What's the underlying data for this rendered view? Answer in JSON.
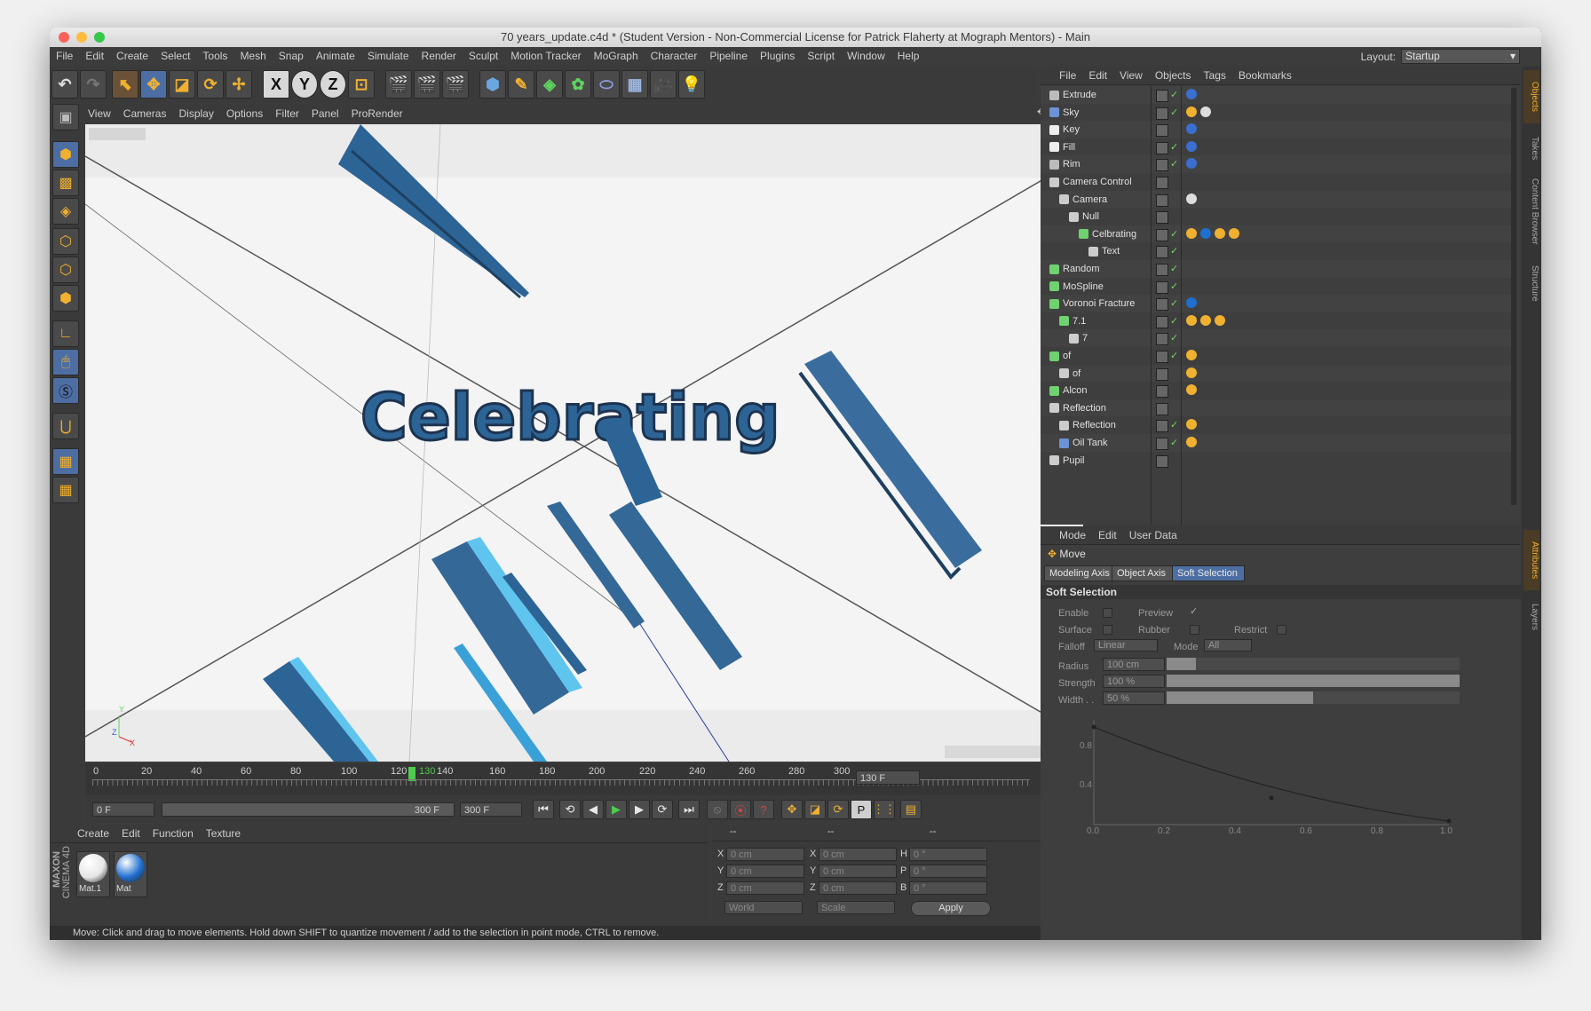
{
  "window": {
    "title": "70 years_update.c4d * (Student Version - Non-Commercial License for Patrick Flaherty at Mograph Mentors) - Main"
  },
  "menu": [
    "File",
    "Edit",
    "Create",
    "Select",
    "Tools",
    "Mesh",
    "Snap",
    "Animate",
    "Simulate",
    "Render",
    "Sculpt",
    "Motion Tracker",
    "MoGraph",
    "Character",
    "Pipeline",
    "Plugins",
    "Script",
    "Window",
    "Help"
  ],
  "layout": {
    "label": "Layout:",
    "value": "Startup"
  },
  "viewport": {
    "menu": [
      "View",
      "Cameras",
      "Display",
      "Options",
      "Filter",
      "Panel",
      "ProRender"
    ],
    "text3d": "Celebrating",
    "axis": {
      "x": "X",
      "y": "Y",
      "z": "Z"
    }
  },
  "timeline": {
    "ticks": [
      "0",
      "20",
      "40",
      "60",
      "80",
      "100",
      "120",
      "130",
      "140",
      "160",
      "180",
      "200",
      "220",
      "240",
      "260",
      "280",
      "300"
    ],
    "current": "130 F",
    "start": "0 F",
    "range_end": "300 F",
    "end": "300 F"
  },
  "materials": {
    "menu": [
      "Create",
      "Edit",
      "Function",
      "Texture"
    ],
    "items": [
      {
        "name": "Mat.1",
        "color": "#e6e6e6"
      },
      {
        "name": "Mat",
        "color": "#1f6fd0"
      }
    ],
    "brand1": "MAXON",
    "brand2": "CINEMA 4D"
  },
  "coords": {
    "headers": [
      "--",
      "--",
      "--"
    ],
    "rows": [
      {
        "a": "X",
        "av": "0 cm",
        "b": "X",
        "bv": "0 cm",
        "c": "H",
        "cv": "0 °"
      },
      {
        "a": "Y",
        "av": "0 cm",
        "b": "Y",
        "bv": "0 cm",
        "c": "P",
        "cv": "0 °"
      },
      {
        "a": "Z",
        "av": "0 cm",
        "b": "Z",
        "bv": "0 cm",
        "c": "B",
        "cv": "0 °"
      }
    ],
    "world": "World",
    "scale": "Scale",
    "apply": "Apply"
  },
  "status": "Move: Click and drag to move elements. Hold down SHIFT to quantize movement / add to the selection in point mode, CTRL to remove.",
  "objects": {
    "menu": [
      "File",
      "Edit",
      "View",
      "Objects",
      "Tags",
      "Bookmarks"
    ],
    "rows": [
      {
        "name": "Extrude",
        "indent": 0,
        "color": "#bbbbbb"
      },
      {
        "name": "Sky",
        "indent": 0,
        "color": "#6b93d6"
      },
      {
        "name": "Key",
        "indent": 0,
        "color": "#eeeeee"
      },
      {
        "name": "Fill",
        "indent": 0,
        "color": "#eeeeee"
      },
      {
        "name": "Rim",
        "indent": 0,
        "color": "#bbbbbb"
      },
      {
        "name": "Camera Control",
        "indent": 0,
        "color": "#cccccc"
      },
      {
        "name": "Camera",
        "indent": 1,
        "color": "#cccccc"
      },
      {
        "name": "Null",
        "indent": 2,
        "color": "#cccccc"
      },
      {
        "name": "Celbrating",
        "indent": 3,
        "color": "#6fd16f"
      },
      {
        "name": "Text",
        "indent": 4,
        "color": "#cccccc"
      },
      {
        "name": "Random",
        "indent": 0,
        "color": "#6fd16f"
      },
      {
        "name": "MoSpline",
        "indent": 0,
        "color": "#6fd16f"
      },
      {
        "name": "Voronoi Fracture",
        "indent": 0,
        "color": "#6fd16f"
      },
      {
        "name": "7.1",
        "indent": 1,
        "color": "#6fd16f"
      },
      {
        "name": "7",
        "indent": 2,
        "color": "#cccccc"
      },
      {
        "name": "of",
        "indent": 0,
        "color": "#6fd16f"
      },
      {
        "name": "of",
        "indent": 1,
        "color": "#cccccc"
      },
      {
        "name": "Alcon",
        "indent": 0,
        "color": "#6fd16f"
      },
      {
        "name": "Reflection",
        "indent": 0,
        "color": "#cccccc"
      },
      {
        "name": "Reflection",
        "indent": 1,
        "color": "#cccccc"
      },
      {
        "name": "Oil Tank",
        "indent": 1,
        "color": "#6b93d6"
      },
      {
        "name": "Pupil",
        "indent": 0,
        "color": "#cccccc"
      }
    ]
  },
  "attributes": {
    "menu": [
      "Mode",
      "Edit",
      "User Data"
    ],
    "tool": "Move",
    "tabs": [
      "Modeling Axis",
      "Object Axis",
      "Soft Selection"
    ],
    "section": "Soft Selection",
    "enable": "Enable",
    "preview": "Preview",
    "surface": "Surface",
    "rubber": "Rubber",
    "restrict": "Restrict",
    "falloff": "Falloff",
    "falloff_value": "Linear",
    "mode": "Mode",
    "mode_value": "All",
    "radius": "Radius",
    "radius_value": "100 cm",
    "radius_level": 0.1,
    "strength": "Strength",
    "strength_value": "100 %",
    "strength_level": 1.0,
    "width": "Width . .",
    "width_value": "50 %",
    "width_level": 0.5,
    "graph_y": [
      "0.8",
      "0.4"
    ],
    "graph_x": [
      "0.0",
      "0.2",
      "0.4",
      "0.6",
      "0.8",
      "1.0"
    ]
  },
  "sidetabs": [
    "Objects",
    "Takes",
    "Content Browser",
    "Structure",
    "Attributes",
    "Layers"
  ]
}
